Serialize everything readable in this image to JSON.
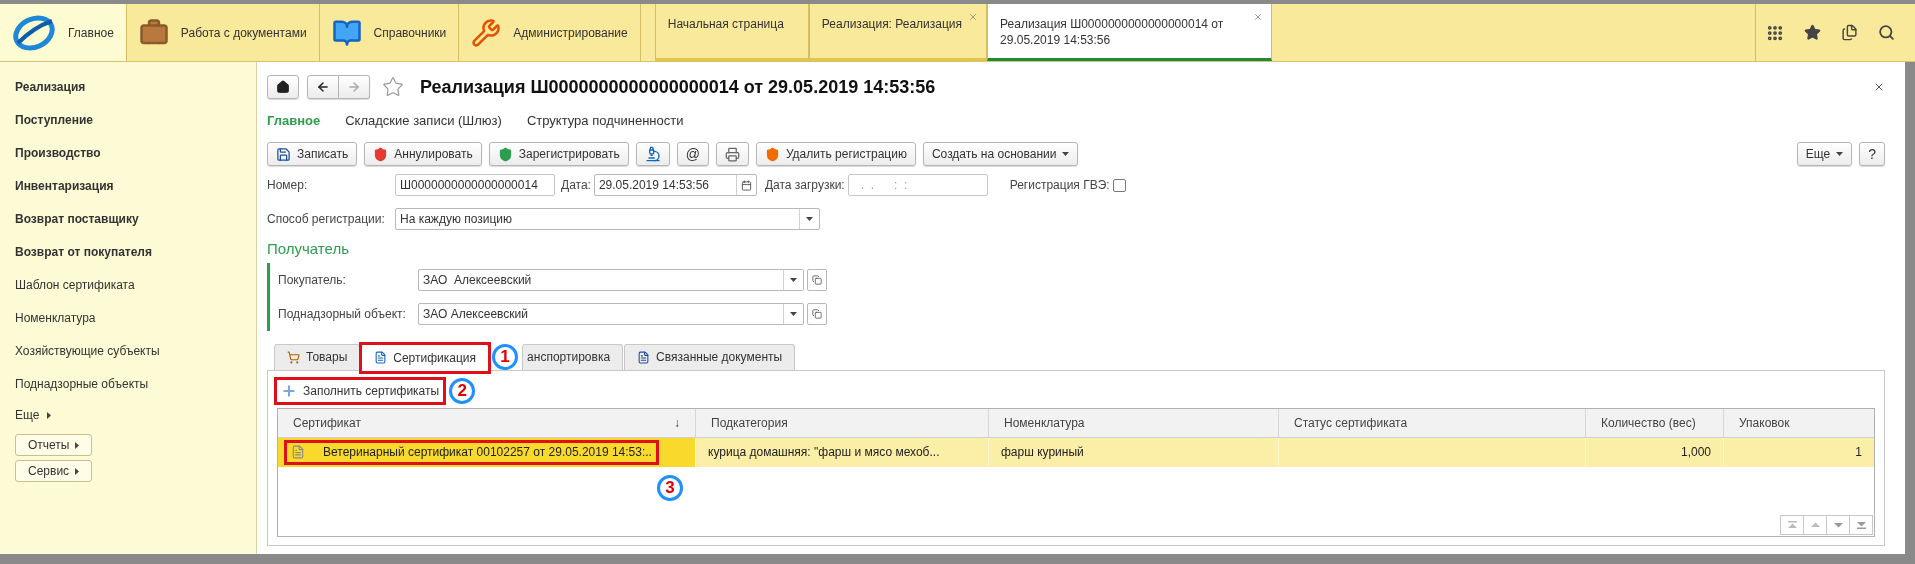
{
  "sections": [
    {
      "label": "Главное",
      "selected": true
    },
    {
      "label": "Работа с документами",
      "selected": false
    },
    {
      "label": "Справочники",
      "selected": false
    },
    {
      "label": "Администрирование",
      "selected": false
    }
  ],
  "open_tabs": [
    {
      "label": "Начальная страница",
      "selected": false,
      "closable": false
    },
    {
      "label": "Реализация: Реализация",
      "selected": false,
      "closable": true
    },
    {
      "label": "Реализация Ш0000000000000000014 от 29.05.2019 14:53:56",
      "selected": true,
      "closable": true
    }
  ],
  "sidebar": {
    "items": [
      {
        "label": "Реализация",
        "kind": "section"
      },
      {
        "label": "Поступление",
        "kind": "section"
      },
      {
        "label": "Производство",
        "kind": "section"
      },
      {
        "label": "Инвентаризация",
        "kind": "section"
      },
      {
        "label": "Возврат поставщику",
        "kind": "section"
      },
      {
        "label": "Возврат от покупателя",
        "kind": "section"
      },
      {
        "label": "Шаблон сертификата",
        "kind": "link"
      },
      {
        "label": "Номенклатура",
        "kind": "link"
      },
      {
        "label": "Хозяйствующие субъекты",
        "kind": "link"
      },
      {
        "label": "Поднадзорные объекты",
        "kind": "link"
      }
    ],
    "more": "Еще",
    "buttons": [
      "Отчеты",
      "Сервис"
    ]
  },
  "form": {
    "title": "Реализация Ш0000000000000000014 от 29.05.2019 14:53:56",
    "nav_tabs": [
      {
        "label": "Главное",
        "selected": true
      },
      {
        "label": "Складские записи (Шлюз)",
        "selected": false
      },
      {
        "label": "Структура подчиненности",
        "selected": false
      }
    ],
    "toolbar": [
      {
        "kind": "labeled",
        "label": "Записать"
      },
      {
        "kind": "labeled",
        "label": "Аннулировать"
      },
      {
        "kind": "labeled",
        "label": "Зарегистрировать"
      },
      {
        "kind": "icon"
      },
      {
        "kind": "glyph",
        "label": "@"
      },
      {
        "kind": "icon"
      },
      {
        "kind": "labeled",
        "label": "Удалить регистрацию"
      },
      {
        "kind": "menu",
        "label": "Создать на основании"
      }
    ],
    "toolbar_right": [
      {
        "kind": "menu",
        "label": "Еще"
      },
      {
        "kind": "glyph",
        "label": "?"
      }
    ],
    "number": {
      "label": "Номер:",
      "value": "Ш0000000000000000014"
    },
    "date": {
      "label": "Дата:",
      "value": "29.05.2019 14:53:56"
    },
    "load_date": {
      "label": "Дата загрузки:",
      "placeholder": ".  .      :  :"
    },
    "gve": {
      "label": "Регистрация ГВЭ:",
      "checked": false
    },
    "method": {
      "label": "Способ регистрации:",
      "value": "На каждую позицию"
    },
    "recipient": {
      "title": "Получатель",
      "buyer": {
        "label": "Покупатель:",
        "value": "ЗАО  Алексеевский"
      },
      "object": {
        "label": "Поднадзорный объект:",
        "value": "ЗАО Алексеевский"
      }
    },
    "doc_tabs": [
      {
        "label": "Товары",
        "selected": false
      },
      {
        "label": "Сертификация",
        "selected": true,
        "callout": "1"
      },
      {
        "label": "анспортировка",
        "selected": false
      },
      {
        "label": "Связанные документы",
        "selected": false
      }
    ],
    "fill_button": {
      "label": "Заполнить сертификаты",
      "callout": "2"
    },
    "table": {
      "columns": [
        {
          "label": "Сертификат",
          "sort_mark": "↓",
          "kind": "text"
        },
        {
          "label": "Подкатегория",
          "kind": "text"
        },
        {
          "label": "Номенклатура",
          "kind": "text"
        },
        {
          "label": "Статус сертификата",
          "kind": "text"
        },
        {
          "label": "Количество (вес)",
          "kind": "number"
        },
        {
          "label": "Упаковок",
          "kind": "number"
        }
      ],
      "rows": [
        {
          "selected": true,
          "callout": "3",
          "cells": [
            "Ветеринарный сертификат 00102257 от 29.05.2019 14:53:..",
            "курица домашняя: \"фарш и мясо мехоб...",
            "фарш куриный",
            "",
            "1,000",
            "1"
          ]
        }
      ]
    }
  }
}
